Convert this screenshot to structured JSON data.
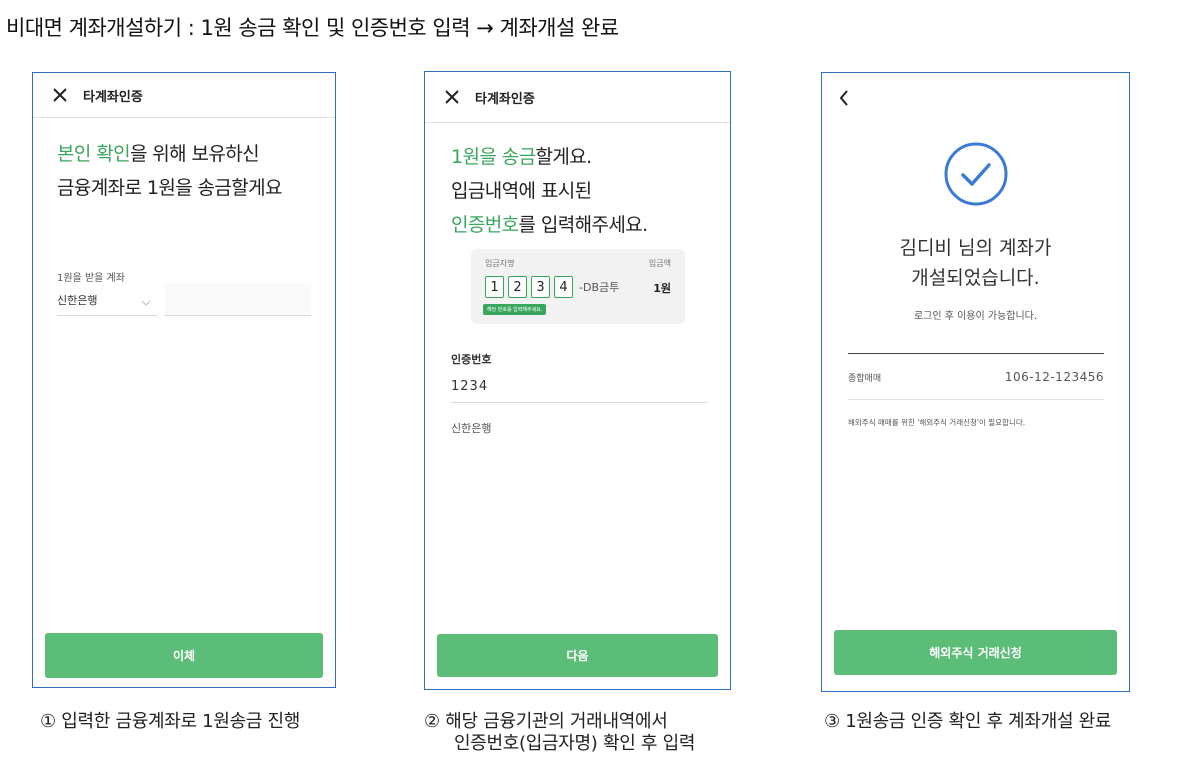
{
  "page_title": "비대면 계좌개설하기 : 1원 송금 확인 및 인증번호 입력 → 계좌개설 완료",
  "screen1": {
    "topbar_title": "타계좌인증",
    "headline_green": "본인 확인",
    "headline_rest1": "을 위해 보유하신",
    "headline_line2": "금융계좌로 1원을 송금할게요",
    "field_label": "1원을 받을 계좌",
    "bank_select": "신한은행",
    "submit_button": "이체"
  },
  "screen2": {
    "topbar_title": "타계좌인증",
    "headline_green1": "1원을 송금",
    "headline_rest1": "할게요.",
    "headline_line2": "입금내역에 표시된",
    "headline_green3": "인증번호",
    "headline_rest3": "를 입력해주세요.",
    "card": {
      "depositor_label": "입금자명",
      "amount_label": "입금액",
      "digits": [
        "1",
        "2",
        "3",
        "4"
      ],
      "suffix": "-DB금투",
      "amount": "1원",
      "hint_tag": "해당 번호를 입력해주세요."
    },
    "auth_label": "인증번호",
    "auth_value": "1234",
    "bank_name": "신한은행",
    "next_button": "다음"
  },
  "screen3": {
    "success_line1": "김디비 님의 계좌가",
    "success_line2": "개설되었습니다.",
    "login_note": "로그인 후 이용이 가능합니다.",
    "account_type": "종합매매",
    "account_number": "106-12-123456",
    "foreign_note": "해외주식 매매를 위한 '해외주식 거래신청'이 필요합니다.",
    "foreign_button": "해외주식 거래신청"
  },
  "captions": {
    "c1": "① 입력한 금융계좌로 1원송금 진행",
    "c2_line1": "② 해당 금융기관의 거래내역에서",
    "c2_line2": "인증번호(입금자명) 확인 후 입력",
    "c3": "③ 1원송금 인증 확인 후 계좌개설 완료"
  },
  "colors": {
    "accent_green": "#5bbd77",
    "text_green": "#3aa55c",
    "frame_blue": "#2f6fbf",
    "check_blue": "#3a7bd5"
  }
}
